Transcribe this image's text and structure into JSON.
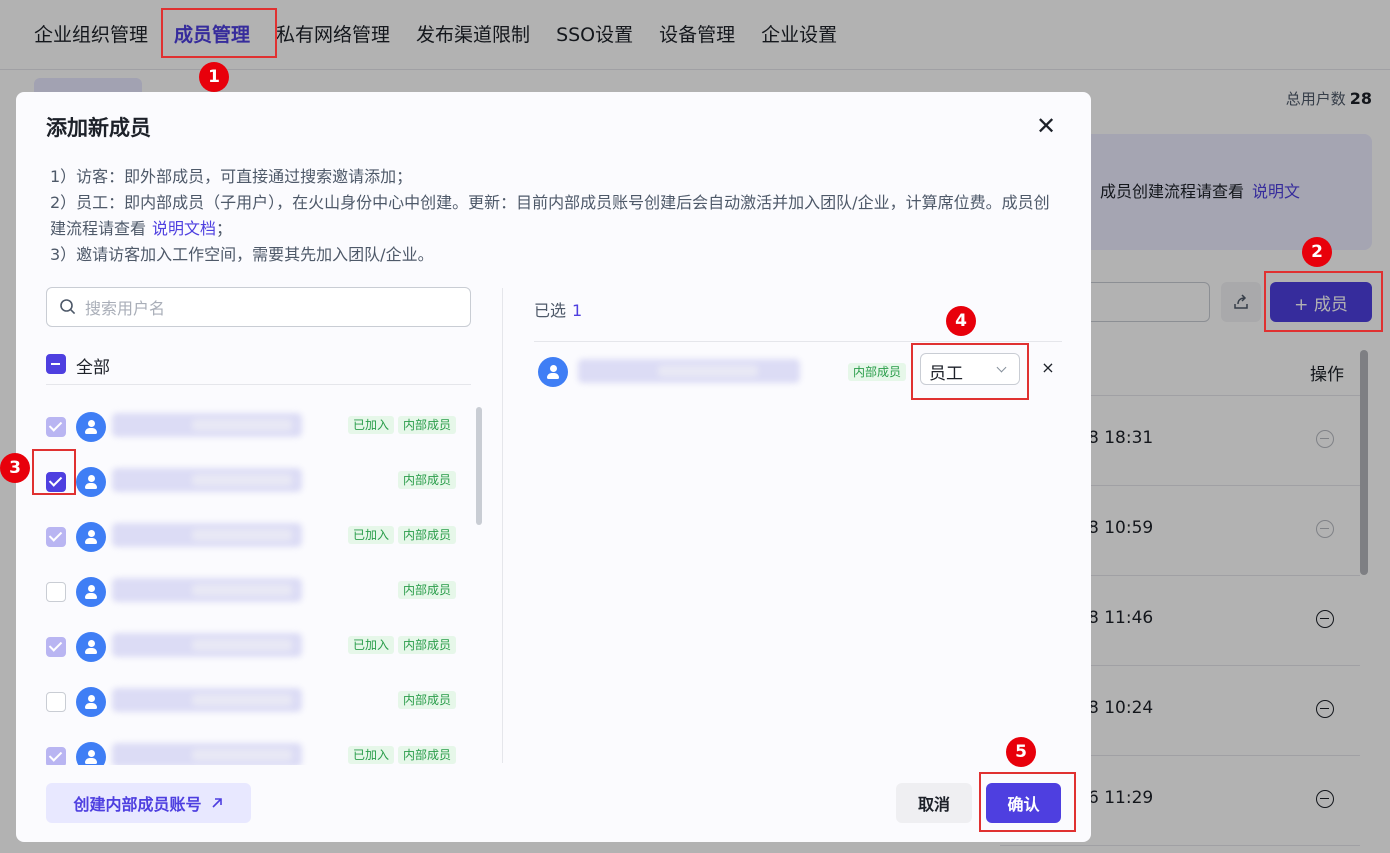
{
  "topnav": {
    "items": [
      "企业组织管理",
      "成员管理",
      "私有网络管理",
      "发布渠道限制",
      "SSO设置",
      "设备管理",
      "企业设置"
    ],
    "active_index": 1
  },
  "background": {
    "total_users_label": "总用户数",
    "total_users_count": "28",
    "banner_text": "成员创建流程请查看",
    "banner_link": "说明文",
    "add_member_button": "+ 成员",
    "table_op_header": "操作",
    "rows": [
      {
        "time": "8 18:31",
        "removable": false
      },
      {
        "time": "8 10:59",
        "removable": false
      },
      {
        "time": "8 11:46",
        "removable": true
      },
      {
        "time": "8 10:24",
        "removable": true
      },
      {
        "time": "6 11:29",
        "removable": true
      }
    ]
  },
  "modal": {
    "title": "添加新成员",
    "close_icon": "close-icon",
    "desc_line1": "1）访客：即外部成员，可直接通过搜索邀请添加；",
    "desc_line2": "2）员工：即内部成员（子用户），在火山身份中心中创建。更新：目前内部成员账号创建后会自动激活并加入团队/企业，计算席位费。成员创建流程请查看",
    "desc_link": "说明文档",
    "desc_line2_tail": "；",
    "desc_line3": "3）邀请访客加入工作空间，需要其先加入团队/企业。",
    "search_placeholder": "搜索用户名",
    "select_all_label": "全部",
    "users": [
      {
        "state": "checked-disabled",
        "tags": [
          "已加入",
          "内部成员"
        ]
      },
      {
        "state": "checked",
        "tags": [
          "内部成员"
        ]
      },
      {
        "state": "checked-disabled",
        "tags": [
          "已加入",
          "内部成员"
        ]
      },
      {
        "state": "unchecked",
        "tags": [
          "内部成员"
        ]
      },
      {
        "state": "checked-disabled",
        "tags": [
          "已加入",
          "内部成员"
        ]
      },
      {
        "state": "unchecked",
        "tags": [
          "内部成员"
        ]
      },
      {
        "state": "checked-disabled",
        "tags": [
          "已加入",
          "内部成员"
        ]
      }
    ],
    "selected_label": "已选",
    "selected_count": "1",
    "selected_user_tag": "内部成员",
    "role_value": "员工",
    "remove_symbol": "×",
    "create_internal_button": "创建内部成员账号",
    "create_internal_icon": "external-arrow-icon",
    "cancel_button": "取消",
    "confirm_button": "确认"
  },
  "annotations": [
    "1",
    "2",
    "3",
    "4",
    "5"
  ],
  "colors": {
    "accent": "#4e3fe0",
    "annotation": "#e8000b",
    "tag_bg": "#e6f7e9",
    "tag_text": "#2a9d4a",
    "avatar": "#3f7ef5"
  }
}
